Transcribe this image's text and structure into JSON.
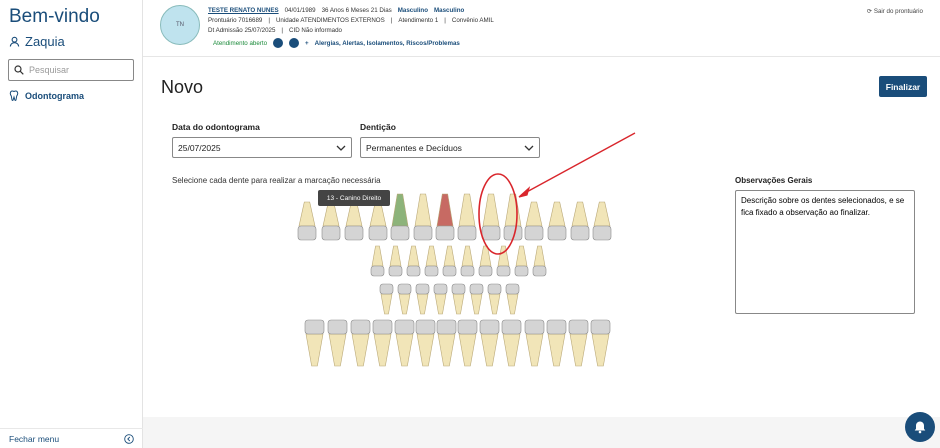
{
  "sidebar": {
    "welcome": "Bem-vindo",
    "user_name": "Zaquia",
    "search_placeholder": "Pesquisar",
    "nav_item": "Odontograma",
    "close_menu": "Fechar menu"
  },
  "patient": {
    "initials": "TN",
    "name": "TESTE RENATO NUNES",
    "birth": "04/01/1989",
    "age": "36 Anos 6 Meses 21 Dias",
    "sex1": "Masculino",
    "sex2": "Masculino",
    "prontuario": "Prontuário 7016689",
    "unidade": "Unidade ATENDIMENTOS EXTERNOS",
    "atendimento": "Atendimento 1",
    "convenio": "Convênio AMIL",
    "admissao": "Dt Admissão 25/07/2025",
    "cid": "CID Não informado",
    "status": "Atendimento aberto",
    "alerts": "Alergias, Alertas, Isolamentos, Riscos/Problemas",
    "exit": "Sair do prontuário"
  },
  "page": {
    "title": "Novo",
    "finalize": "Finalizar",
    "date_label": "Data do odontograma",
    "date_value": "25/07/2025",
    "dentition_label": "Dentição",
    "dentition_value": "Permanentes e Decíduos",
    "hint": "Selecione cada dente para realizar a marcação necessária",
    "obs_label": "Observações Gerais",
    "obs_value": "Descrição sobre os dentes selecionados, e se fica fixado a observação ao finalizar.",
    "tooltip": "13 - Canino Direito"
  },
  "colors": {
    "accent": "#1a4d7a",
    "tooth_green": "#8db37a",
    "tooth_red": "#c76a63",
    "annotation": "#d9262c"
  }
}
